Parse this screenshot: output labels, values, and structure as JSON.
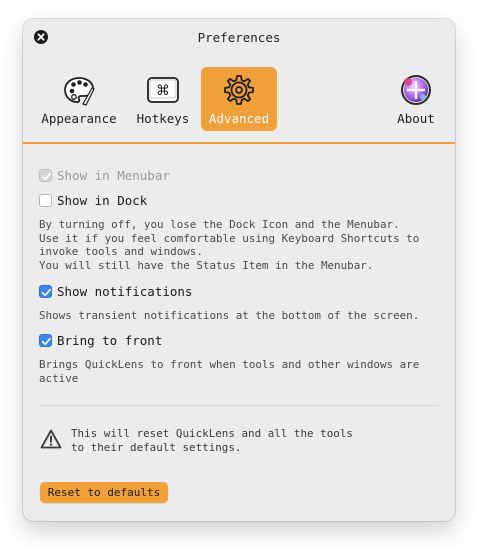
{
  "window": {
    "title": "Preferences"
  },
  "tabs": [
    {
      "label": "Appearance",
      "icon": "palette-icon",
      "active": false
    },
    {
      "label": "Hotkeys",
      "icon": "command-key-icon",
      "active": false
    },
    {
      "label": "Advanced",
      "icon": "gear-icon",
      "active": true
    },
    {
      "label": "About",
      "icon": "app-logo-icon",
      "active": false
    }
  ],
  "options": {
    "show_in_menubar": {
      "label": "Show in Menubar",
      "checked": true,
      "disabled": true
    },
    "show_in_dock": {
      "label": "Show in Dock",
      "checked": false,
      "description": "By turning off, you lose the Dock Icon and the Menubar.\nUse it if you feel comfortable using Keyboard Shortcuts to\ninvoke tools and windows.\nYou will still have the Status Item in the Menubar."
    },
    "show_notifications": {
      "label": "Show notifications",
      "checked": true,
      "description": "Shows transient notifications at the bottom of the screen."
    },
    "bring_to_front": {
      "label": "Bring to front",
      "checked": true,
      "description": "Brings QuickLens to front when tools and other windows are\nactive"
    }
  },
  "reset": {
    "warning": "This will reset QuickLens and all the tools\nto their default settings.",
    "button_label": "Reset to defaults"
  },
  "colors": {
    "accent": "#f0a03a",
    "checkbox_on": "#3b86e6",
    "window_bg": "#ececec"
  }
}
